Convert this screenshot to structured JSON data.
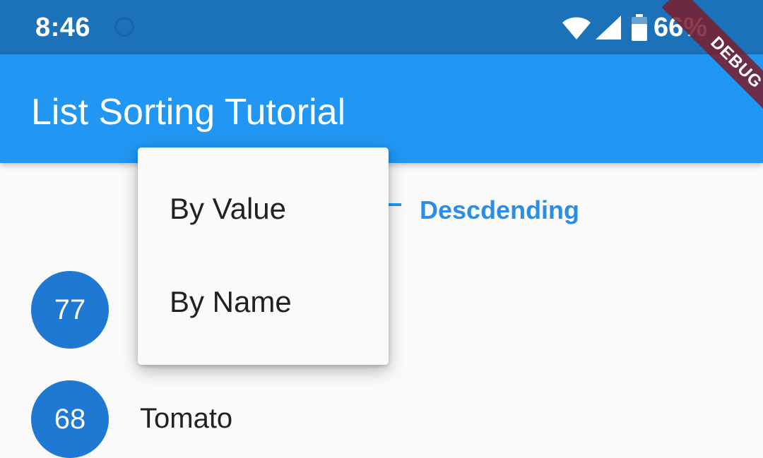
{
  "status_bar": {
    "time": "8:46",
    "battery": "66%",
    "icons": [
      "wifi-icon",
      "signal-icon",
      "battery-icon"
    ]
  },
  "app_bar": {
    "title": "List Sorting Tutorial"
  },
  "controls": {
    "order_label": "Descdending"
  },
  "popup_menu": {
    "items": [
      {
        "label": "By Value"
      },
      {
        "label": "By Name"
      }
    ]
  },
  "list": {
    "items": [
      {
        "value": "77",
        "name": ""
      },
      {
        "value": "68",
        "name": "Tomato"
      }
    ]
  },
  "debug_banner": {
    "label": "DEBUG"
  },
  "colors": {
    "status_bar": "#1b72b9",
    "app_bar": "#2196f3",
    "accent": "#2196f3",
    "avatar": "#1f78d1",
    "debug_banner": "#791c2d"
  }
}
